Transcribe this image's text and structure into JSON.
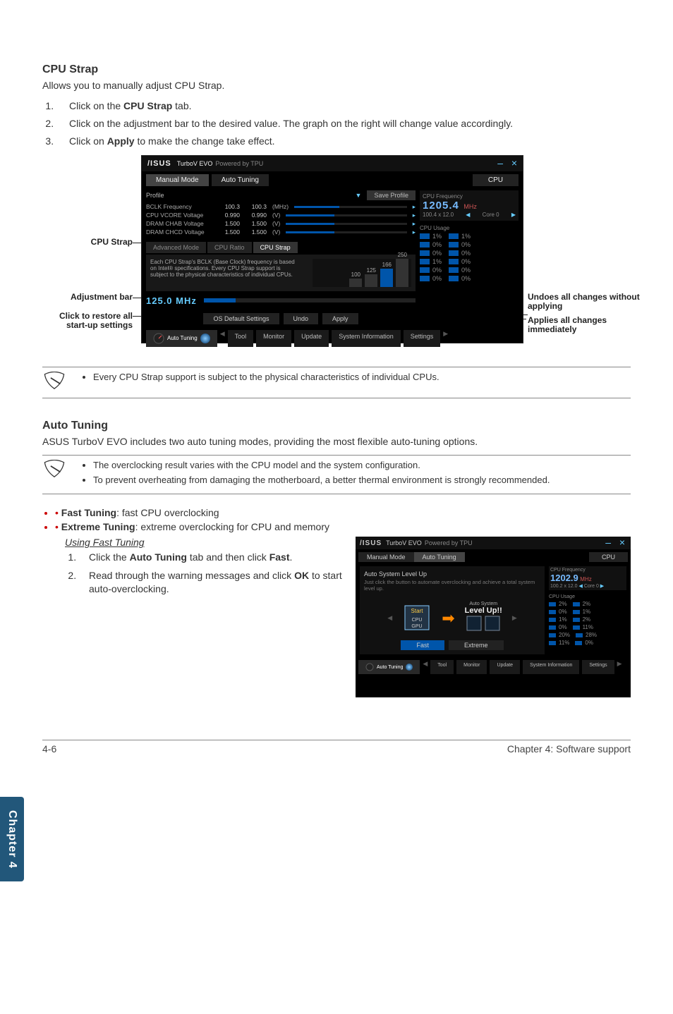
{
  "section_cpu_strap": {
    "title": "CPU Strap",
    "intro": "Allows you to manually adjust CPU Strap.",
    "steps": [
      {
        "pre": "Click on the ",
        "bold": "CPU Strap",
        "post": " tab."
      },
      {
        "pre": "Click on the adjustment bar to the desired value. The graph on the right will change value accordingly.",
        "bold": "",
        "post": ""
      },
      {
        "pre": "Click on ",
        "bold": "Apply",
        "post": " to make the change take effect."
      }
    ]
  },
  "app": {
    "title_prefix": "TurboV EVO",
    "title_suffix": "Powered by TPU",
    "tabs": {
      "manual": "Manual Mode",
      "auto": "Auto Tuning",
      "cpu": "CPU"
    },
    "profile": {
      "label": "Profile",
      "save": "Save Profile"
    },
    "metrics": [
      {
        "name": "BCLK Frequency",
        "v1": "100.3",
        "v2": "100.3",
        "unit": "(MHz)"
      },
      {
        "name": "CPU VCORE Voltage",
        "v1": "0.990",
        "v2": "0.990",
        "unit": "(V)"
      },
      {
        "name": "DRAM CHAB Voltage",
        "v1": "1.500",
        "v2": "1.500",
        "unit": "(V)"
      },
      {
        "name": "DRAM CHCD Voltage",
        "v1": "1.500",
        "v2": "1.500",
        "unit": "(V)"
      }
    ],
    "subtabs": {
      "adv": "Advanced Mode",
      "ratio": "CPU Ratio",
      "strap": "CPU Strap"
    },
    "strap_desc": "Each CPU Strap's BCLK (Base Clock) frequency is based on Intel® specifications. Every CPU Strap support is subject to the physical characteristics of individual CPUs.",
    "ticks": {
      "a": "250",
      "b": "166",
      "c": "125",
      "d": "100"
    },
    "adj_value": "125.0 MHz",
    "freq": {
      "label": "CPU Frequency",
      "value": "1205.4",
      "unit": "MHz",
      "sub": "100.4 x 12.0",
      "core": "Core 0"
    },
    "usage": {
      "label": "CPU Usage",
      "rows": [
        [
          "1%",
          "1%"
        ],
        [
          "0%",
          "0%"
        ],
        [
          "0%",
          "0%"
        ],
        [
          "1%",
          "0%"
        ],
        [
          "0%",
          "0%"
        ],
        [
          "0%",
          "0%"
        ]
      ]
    },
    "actions": {
      "defaults": "OS Default Settings",
      "undo": "Undo",
      "apply": "Apply"
    },
    "nav": {
      "auto": "Auto Tuning",
      "tool": "Tool",
      "monitor": "Monitor",
      "update": "Update",
      "sysinfo": "System Information",
      "settings": "Settings"
    }
  },
  "callouts": {
    "cpu_strap": "CPU Strap",
    "adjustment_bar": "Adjustment bar",
    "restore": "Click to restore all start-up settings",
    "undo": "Undoes all changes without applying",
    "apply": "Applies all changes immediately"
  },
  "note_single": "Every CPU Strap support is subject to the physical characteristics of individual CPUs.",
  "section_auto": {
    "title": "Auto Tuning",
    "intro": "ASUS TurboV EVO includes two auto tuning modes, providing the most flexible auto-tuning options.",
    "notes": [
      "The overclocking result varies with the CPU model and the system configuration.",
      "To prevent overheating from damaging the motherboard, a better thermal environment is strongly recommended."
    ],
    "features": [
      {
        "bold": "Fast Tuning",
        "rest": ": fast CPU overclocking"
      },
      {
        "bold": "Extreme Tuning",
        "rest": ": extreme overclocking for CPU and memory"
      }
    ],
    "fast": {
      "heading": "Using Fast Tuning",
      "steps": [
        {
          "pre": "Click the ",
          "b1": "Auto Tuning",
          "mid": " tab and then click ",
          "b2": "Fast",
          "post": "."
        },
        {
          "pre": "Read through the warning messages and click ",
          "b1": "OK",
          "mid": " to start auto-overclocking.",
          "b2": "",
          "post": ""
        }
      ]
    }
  },
  "mini": {
    "title_prefix": "TurboV EVO",
    "title_suffix": "Powered by TPU",
    "tabs": {
      "manual": "Manual Mode",
      "auto": "Auto Tuning",
      "cpu": "CPU"
    },
    "head": "Auto System Level Up",
    "sub": "Just click the button to automate overclocking and achieve a total system level up.",
    "badge_top": "Auto System",
    "badge": "Level Up!!",
    "start": "Start",
    "cpu_lbl": "CPU",
    "gpu_lbl": "GPU",
    "freq": {
      "label": "CPU Frequency",
      "value": "1202.9",
      "unit": "MHz",
      "sub": "100.2 x 12.0",
      "core": "Core 0"
    },
    "usage_label": "CPU Usage",
    "usage": [
      [
        "2%",
        "2%"
      ],
      [
        "0%",
        "1%"
      ],
      [
        "1%",
        "2%"
      ],
      [
        "0%",
        "11%"
      ],
      [
        "20%",
        "28%"
      ],
      [
        "11%",
        "0%"
      ]
    ],
    "fast": "Fast",
    "extreme": "Extreme",
    "nav": {
      "auto": "Auto Tuning",
      "tool": "Tool",
      "monitor": "Monitor",
      "update": "Update",
      "sysinfo": "System Information",
      "settings": "Settings"
    }
  },
  "side_tab": "Chapter 4",
  "footer": {
    "left": "4-6",
    "right": "Chapter 4: Software support"
  }
}
